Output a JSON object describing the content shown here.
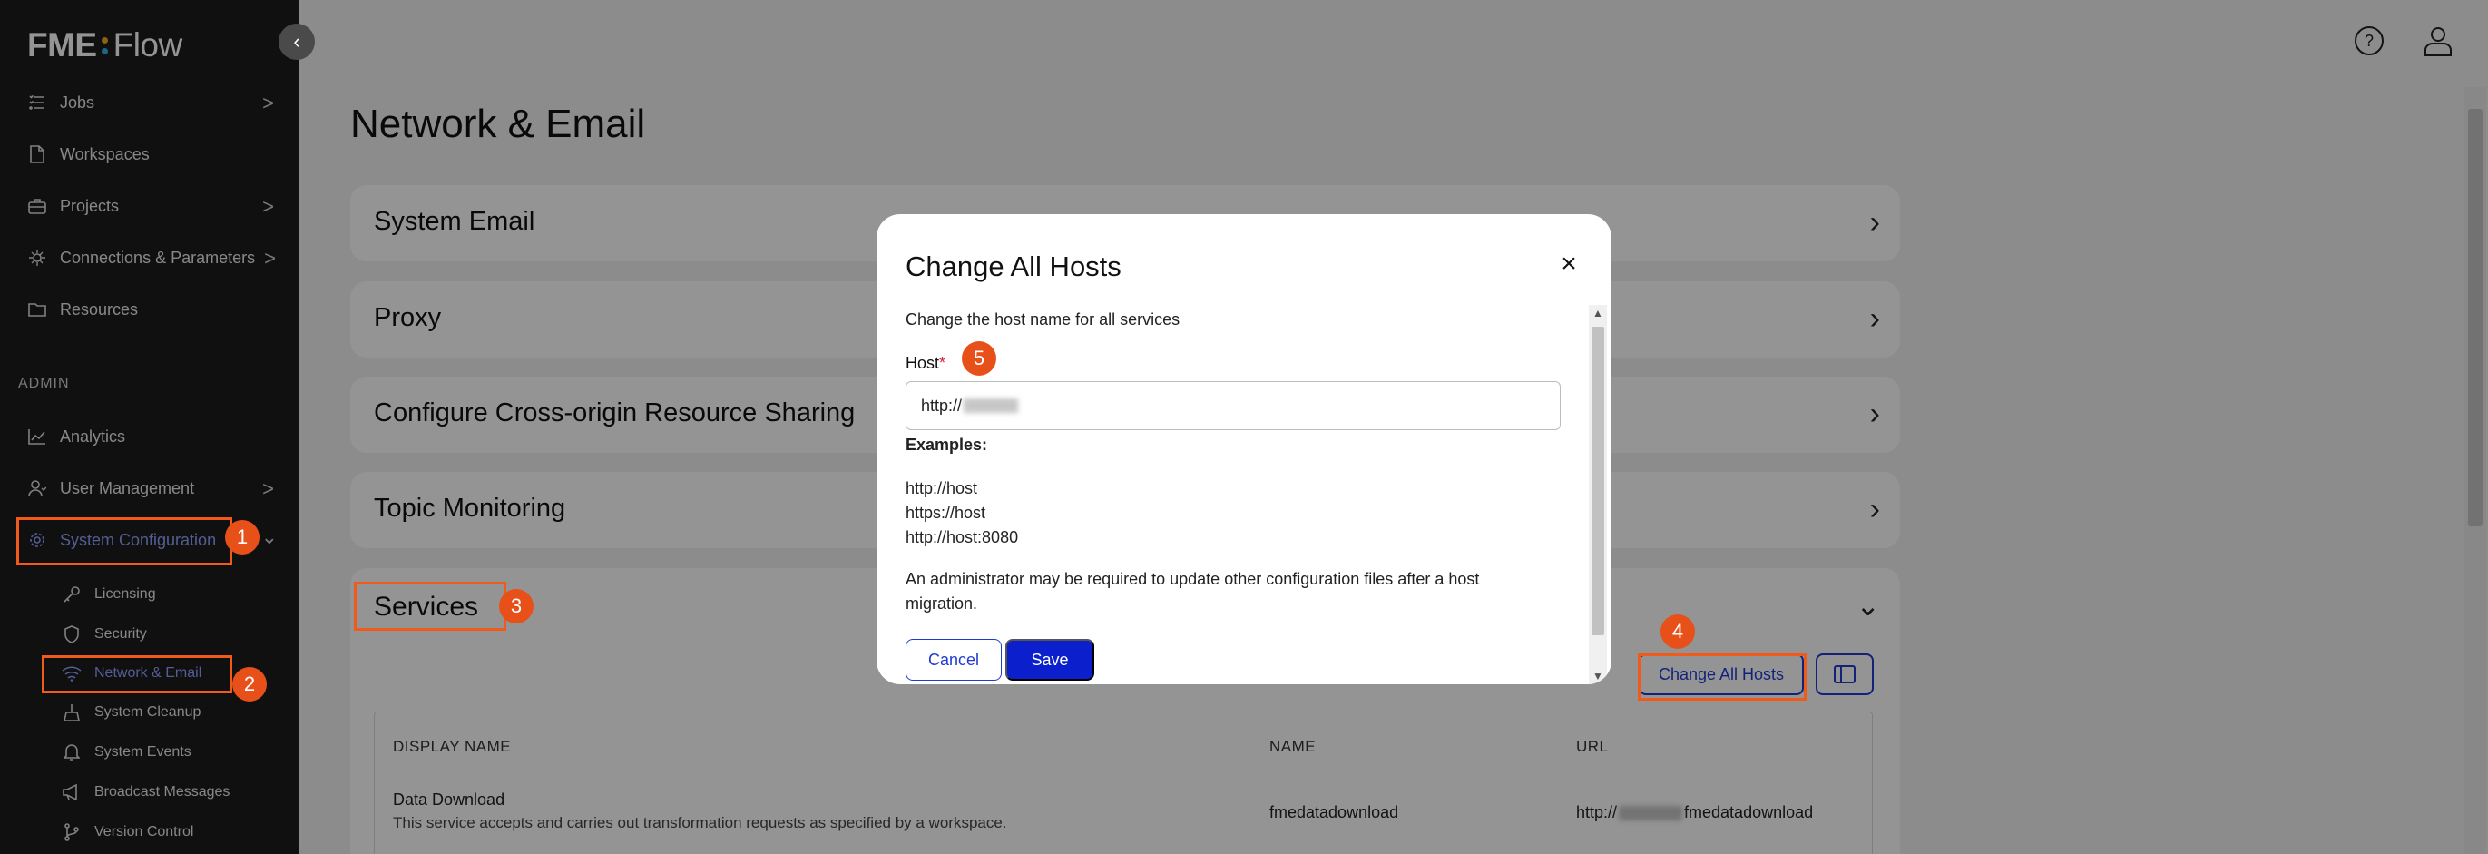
{
  "app": {
    "logo_fme": "FME",
    "logo_flow": "Flow",
    "logo_dot_colors": [
      "#f4a51c",
      "#2fb3e6"
    ]
  },
  "sidebar": {
    "nav": [
      {
        "label": "Jobs",
        "icon": "list-icon",
        "chevron": ">"
      },
      {
        "label": "Workspaces",
        "icon": "file-icon",
        "chevron": ""
      },
      {
        "label": "Projects",
        "icon": "briefcase-icon",
        "chevron": ">"
      },
      {
        "label": "Connections & Parameters",
        "icon": "connections-icon",
        "chevron": ">"
      },
      {
        "label": "Resources",
        "icon": "folder-icon",
        "chevron": ""
      }
    ],
    "admin_label": "ADMIN",
    "admin_nav": [
      {
        "label": "Analytics",
        "icon": "chart-icon",
        "chevron": ""
      },
      {
        "label": "User Management",
        "icon": "users-icon",
        "chevron": ">"
      },
      {
        "label": "System Configuration",
        "icon": "gear-icon",
        "chevron": "⌄"
      }
    ],
    "sub_items": [
      {
        "label": "Licensing",
        "icon": "key-icon"
      },
      {
        "label": "Security",
        "icon": "shield-icon"
      },
      {
        "label": "Network & Email",
        "icon": "wifi-icon"
      },
      {
        "label": "System Cleanup",
        "icon": "broom-icon"
      },
      {
        "label": "System Events",
        "icon": "bell-icon"
      },
      {
        "label": "Broadcast Messages",
        "icon": "megaphone-icon"
      },
      {
        "label": "Version Control",
        "icon": "branch-icon"
      }
    ]
  },
  "main": {
    "title": "Network & Email",
    "panels": [
      {
        "title": "System Email"
      },
      {
        "title": "Proxy"
      },
      {
        "title": "Configure Cross-origin Resource Sharing"
      },
      {
        "title": "Topic Monitoring"
      }
    ],
    "services": {
      "title": "Services",
      "change_all_hosts_label": "Change All Hosts",
      "columns": [
        "DISPLAY NAME",
        "NAME",
        "URL"
      ],
      "rows": [
        {
          "display_name": "Data Download",
          "description": "This service accepts and carries out transformation requests as specified by a workspace.",
          "name": "fmedatadownload",
          "url_prefix": "http://",
          "url_suffix": "fmedatadownload"
        }
      ]
    }
  },
  "modal": {
    "title": "Change All Hosts",
    "close_icon": "×",
    "description": "Change the host name for all services",
    "host_label": "Host",
    "required_mark": "*",
    "host_value_prefix": "http://",
    "examples_label": "Examples:",
    "examples": [
      "http://host",
      "https://host",
      "http://host:8080"
    ],
    "note_line1": "An administrator may be required to update other configuration files after a host",
    "note_line2": "migration.",
    "cancel_label": "Cancel",
    "save_label": "Save"
  },
  "annotations": {
    "markers": [
      "1",
      "2",
      "3",
      "4",
      "5"
    ],
    "highlight_color": "#f05a1a"
  },
  "colors": {
    "accent": "#1f3bd1",
    "primary_button": "#0b1fcc",
    "sidebar_bg": "#1c1c1c",
    "active_nav": "#8ea2ff"
  }
}
